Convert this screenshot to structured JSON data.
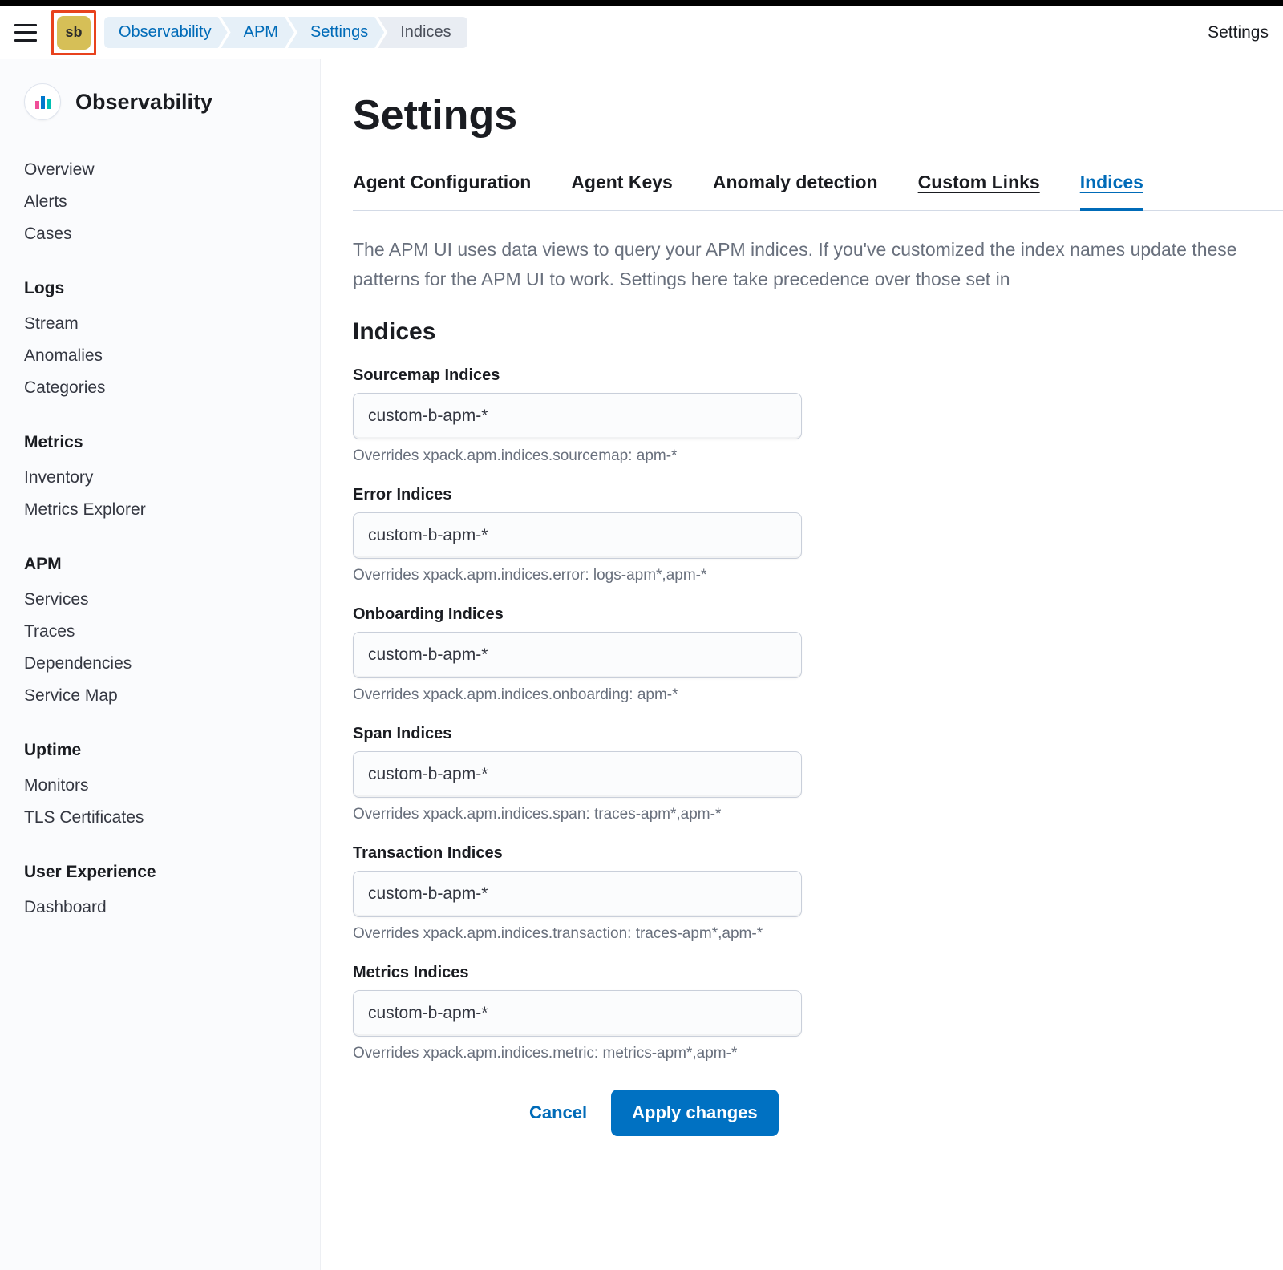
{
  "header": {
    "sb_label": "sb",
    "breadcrumbs": [
      "Observability",
      "APM",
      "Settings",
      "Indices"
    ],
    "right_link": "Settings"
  },
  "sidebar": {
    "title": "Observability",
    "groups": [
      {
        "label": null,
        "items": [
          "Overview",
          "Alerts",
          "Cases"
        ]
      },
      {
        "label": "Logs",
        "items": [
          "Stream",
          "Anomalies",
          "Categories"
        ]
      },
      {
        "label": "Metrics",
        "items": [
          "Inventory",
          "Metrics Explorer"
        ]
      },
      {
        "label": "APM",
        "items": [
          "Services",
          "Traces",
          "Dependencies",
          "Service Map"
        ]
      },
      {
        "label": "Uptime",
        "items": [
          "Monitors",
          "TLS Certificates"
        ]
      },
      {
        "label": "User Experience",
        "items": [
          "Dashboard"
        ]
      }
    ]
  },
  "main": {
    "title": "Settings",
    "tabs": [
      {
        "label": "Agent Configuration",
        "active": false
      },
      {
        "label": "Agent Keys",
        "active": false
      },
      {
        "label": "Anomaly detection",
        "active": false
      },
      {
        "label": "Custom Links",
        "active": false,
        "underline": true
      },
      {
        "label": "Indices",
        "active": true
      }
    ],
    "description": "The APM UI uses data views to query your APM indices. If you've customized the index names update these patterns for the APM UI to work. Settings here take precedence over those set in",
    "section_title": "Indices",
    "fields": [
      {
        "label": "Sourcemap Indices",
        "value": "custom-b-apm-*",
        "help": "Overrides xpack.apm.indices.sourcemap: apm-*"
      },
      {
        "label": "Error Indices",
        "value": "custom-b-apm-*",
        "help": "Overrides xpack.apm.indices.error: logs-apm*,apm-*"
      },
      {
        "label": "Onboarding Indices",
        "value": "custom-b-apm-*",
        "help": "Overrides xpack.apm.indices.onboarding: apm-*"
      },
      {
        "label": "Span Indices",
        "value": "custom-b-apm-*",
        "help": "Overrides xpack.apm.indices.span: traces-apm*,apm-*"
      },
      {
        "label": "Transaction Indices",
        "value": "custom-b-apm-*",
        "help": "Overrides xpack.apm.indices.transaction: traces-apm*,apm-*"
      },
      {
        "label": "Metrics Indices",
        "value": "custom-b-apm-*",
        "help": "Overrides xpack.apm.indices.metric: metrics-apm*,apm-*"
      }
    ],
    "actions": {
      "cancel": "Cancel",
      "apply": "Apply changes"
    }
  }
}
